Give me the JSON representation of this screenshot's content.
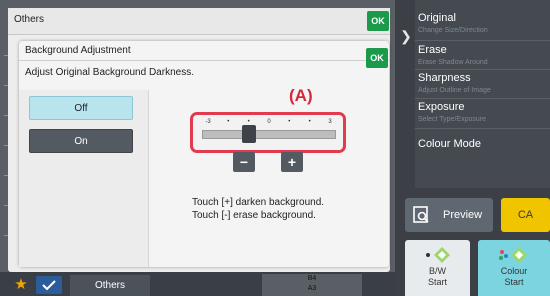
{
  "back_dialog": {
    "title": "Others",
    "ok_label": "OK"
  },
  "front_dialog": {
    "title": "Background Adjustment",
    "ok_label": "OK",
    "description": "Adjust Original Background Darkness.",
    "options": [
      {
        "label": "Off",
        "selected": true
      },
      {
        "label": "On",
        "selected": false
      }
    ],
    "slider": {
      "ticks": [
        "-3",
        "•",
        "•",
        "0",
        "•",
        "•",
        "3"
      ],
      "min": -3,
      "max": 3,
      "value": -1
    },
    "callout_label": "(A)",
    "minus_label": "−",
    "plus_label": "+",
    "hints": [
      "Touch [+] darken background.",
      "Touch [-] erase background."
    ]
  },
  "right_menu": {
    "items": [
      {
        "title": "Original",
        "subtitle": "Change Size/Direction"
      },
      {
        "title": "Erase",
        "subtitle": "Erase Shadow Around"
      },
      {
        "title": "Sharpness",
        "subtitle": "Adjust Outline of Image"
      },
      {
        "title": "Exposure",
        "subtitle": "Select Type/Exposure"
      },
      {
        "title": "Colour Mode",
        "subtitle": ""
      }
    ],
    "preview_label": "Preview",
    "ca_label": "CA",
    "bw_start": {
      "line1": "B/W",
      "line2": "Start"
    },
    "colour_start": {
      "line1": "Colour",
      "line2": "Start"
    }
  },
  "bottom_bar": {
    "others_label": "Others",
    "paper_sizes": [
      "B4",
      "A3"
    ]
  },
  "colors": {
    "ok_green": "#1a9a4a",
    "callout_red": "#e23b4f",
    "ca_yellow": "#f1c400",
    "colour_start": "#7cd4e0",
    "selected_option": "#b8e4ee"
  },
  "icons": [
    "chevron-right-icon",
    "preview-icon",
    "star-icon",
    "checkmark-icon",
    "bw-start-icon",
    "colour-start-icon"
  ]
}
